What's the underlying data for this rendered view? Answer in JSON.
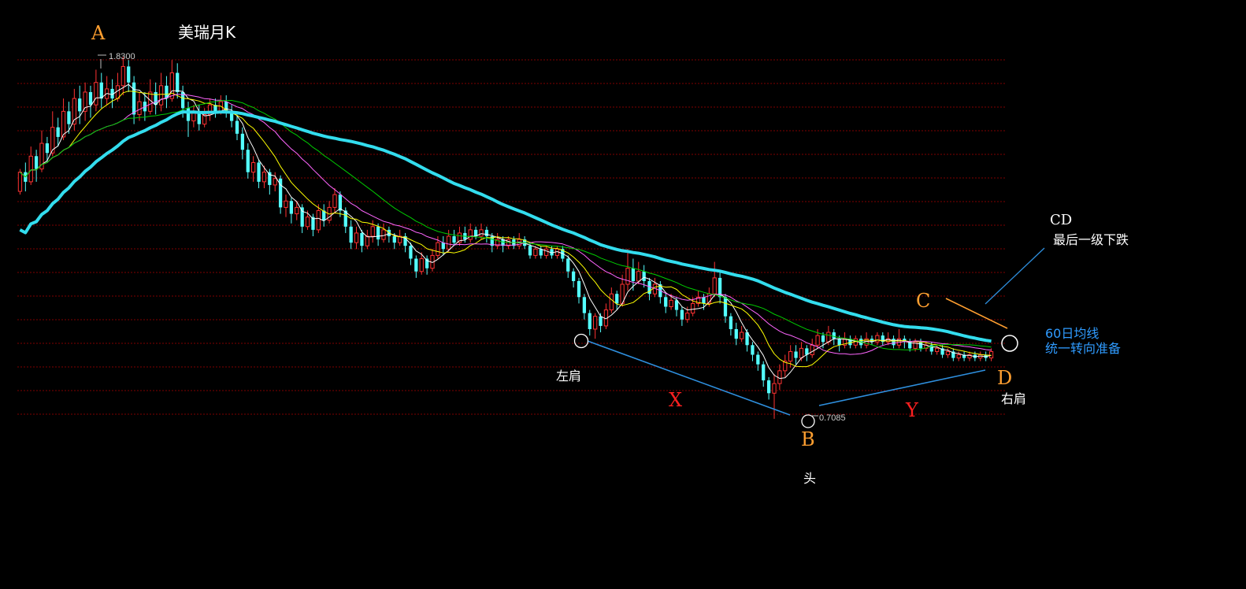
{
  "chart_data": {
    "type": "candlestick",
    "title": "美瑞月K",
    "price_labels": {
      "high": "1.8300",
      "low": "0.7085"
    },
    "ylim": [
      0.68,
      1.86
    ],
    "candle_count": 210,
    "candles": [
      {
        "o": 1.41,
        "c": 1.47,
        "h": 1.48,
        "l": 1.4
      },
      {
        "o": 1.47,
        "c": 1.44,
        "h": 1.5,
        "l": 1.41
      },
      {
        "o": 1.44,
        "c": 1.52,
        "h": 1.55,
        "l": 1.43
      },
      {
        "o": 1.52,
        "c": 1.48,
        "h": 1.54,
        "l": 1.44
      },
      {
        "o": 1.48,
        "c": 1.56,
        "h": 1.6,
        "l": 1.47
      },
      {
        "o": 1.56,
        "c": 1.53,
        "h": 1.58,
        "l": 1.5
      },
      {
        "o": 1.53,
        "c": 1.61,
        "h": 1.66,
        "l": 1.52
      },
      {
        "o": 1.61,
        "c": 1.58,
        "h": 1.64,
        "l": 1.55
      },
      {
        "o": 1.58,
        "c": 1.66,
        "h": 1.7,
        "l": 1.57
      },
      {
        "o": 1.66,
        "c": 1.62,
        "h": 1.69,
        "l": 1.59
      },
      {
        "o": 1.62,
        "c": 1.7,
        "h": 1.73,
        "l": 1.6
      },
      {
        "o": 1.7,
        "c": 1.66,
        "h": 1.74,
        "l": 1.62
      },
      {
        "o": 1.66,
        "c": 1.72,
        "h": 1.75,
        "l": 1.63
      },
      {
        "o": 1.72,
        "c": 1.68,
        "h": 1.74,
        "l": 1.64
      },
      {
        "o": 1.68,
        "c": 1.75,
        "h": 1.79,
        "l": 1.66
      },
      {
        "o": 1.75,
        "c": 1.7,
        "h": 1.78,
        "l": 1.67
      },
      {
        "o": 1.7,
        "c": 1.73,
        "h": 1.77,
        "l": 1.68
      },
      {
        "o": 1.73,
        "c": 1.7,
        "h": 1.76,
        "l": 1.67
      },
      {
        "o": 1.7,
        "c": 1.74,
        "h": 1.78,
        "l": 1.69
      },
      {
        "o": 1.74,
        "c": 1.8,
        "h": 1.83,
        "l": 1.71
      },
      {
        "o": 1.8,
        "c": 1.75,
        "h": 1.82,
        "l": 1.72
      },
      {
        "o": 1.75,
        "c": 1.65,
        "h": 1.77,
        "l": 1.62
      },
      {
        "o": 1.65,
        "c": 1.69,
        "h": 1.72,
        "l": 1.63
      },
      {
        "o": 1.69,
        "c": 1.66,
        "h": 1.72,
        "l": 1.63
      },
      {
        "o": 1.66,
        "c": 1.72,
        "h": 1.76,
        "l": 1.65
      },
      {
        "o": 1.72,
        "c": 1.68,
        "h": 1.75,
        "l": 1.65
      },
      {
        "o": 1.68,
        "c": 1.74,
        "h": 1.78,
        "l": 1.66
      },
      {
        "o": 1.74,
        "c": 1.7,
        "h": 1.77,
        "l": 1.67
      },
      {
        "o": 1.7,
        "c": 1.78,
        "h": 1.82,
        "l": 1.69
      },
      {
        "o": 1.78,
        "c": 1.72,
        "h": 1.81,
        "l": 1.7
      },
      {
        "o": 1.72,
        "c": 1.67,
        "h": 1.74,
        "l": 1.64
      },
      {
        "o": 1.67,
        "c": 1.63,
        "h": 1.69,
        "l": 1.58
      },
      {
        "o": 1.63,
        "c": 1.66,
        "h": 1.68,
        "l": 1.61
      },
      {
        "o": 1.66,
        "c": 1.62,
        "h": 1.68,
        "l": 1.6
      },
      {
        "o": 1.62,
        "c": 1.65,
        "h": 1.67,
        "l": 1.61
      },
      {
        "o": 1.65,
        "c": 1.68,
        "h": 1.7,
        "l": 1.63
      },
      {
        "o": 1.68,
        "c": 1.66,
        "h": 1.7,
        "l": 1.64
      },
      {
        "o": 1.66,
        "c": 1.69,
        "h": 1.71,
        "l": 1.65
      },
      {
        "o": 1.69,
        "c": 1.66,
        "h": 1.71,
        "l": 1.64
      },
      {
        "o": 1.66,
        "c": 1.63,
        "h": 1.68,
        "l": 1.61
      },
      {
        "o": 1.63,
        "c": 1.59,
        "h": 1.65,
        "l": 1.57
      },
      {
        "o": 1.59,
        "c": 1.54,
        "h": 1.61,
        "l": 1.51
      },
      {
        "o": 1.54,
        "c": 1.47,
        "h": 1.56,
        "l": 1.45
      },
      {
        "o": 1.47,
        "c": 1.5,
        "h": 1.52,
        "l": 1.44
      },
      {
        "o": 1.5,
        "c": 1.44,
        "h": 1.51,
        "l": 1.42
      },
      {
        "o": 1.44,
        "c": 1.47,
        "h": 1.49,
        "l": 1.42
      },
      {
        "o": 1.47,
        "c": 1.43,
        "h": 1.48,
        "l": 1.4
      },
      {
        "o": 1.43,
        "c": 1.45,
        "h": 1.47,
        "l": 1.41
      },
      {
        "o": 1.45,
        "c": 1.36,
        "h": 1.46,
        "l": 1.34
      },
      {
        "o": 1.36,
        "c": 1.38,
        "h": 1.4,
        "l": 1.33
      },
      {
        "o": 1.38,
        "c": 1.34,
        "h": 1.39,
        "l": 1.31
      },
      {
        "o": 1.34,
        "c": 1.36,
        "h": 1.38,
        "l": 1.32
      },
      {
        "o": 1.36,
        "c": 1.3,
        "h": 1.37,
        "l": 1.28
      },
      {
        "o": 1.3,
        "c": 1.33,
        "h": 1.35,
        "l": 1.29
      },
      {
        "o": 1.33,
        "c": 1.29,
        "h": 1.34,
        "l": 1.27
      },
      {
        "o": 1.29,
        "c": 1.35,
        "h": 1.37,
        "l": 1.28
      },
      {
        "o": 1.35,
        "c": 1.32,
        "h": 1.37,
        "l": 1.3
      },
      {
        "o": 1.32,
        "c": 1.36,
        "h": 1.38,
        "l": 1.31
      },
      {
        "o": 1.36,
        "c": 1.4,
        "h": 1.42,
        "l": 1.34
      },
      {
        "o": 1.4,
        "c": 1.35,
        "h": 1.41,
        "l": 1.33
      },
      {
        "o": 1.35,
        "c": 1.3,
        "h": 1.36,
        "l": 1.28
      },
      {
        "o": 1.3,
        "c": 1.25,
        "h": 1.32,
        "l": 1.23
      },
      {
        "o": 1.25,
        "c": 1.28,
        "h": 1.3,
        "l": 1.23
      },
      {
        "o": 1.28,
        "c": 1.24,
        "h": 1.29,
        "l": 1.22
      },
      {
        "o": 1.24,
        "c": 1.27,
        "h": 1.29,
        "l": 1.23
      },
      {
        "o": 1.27,
        "c": 1.3,
        "h": 1.32,
        "l": 1.25
      },
      {
        "o": 1.3,
        "c": 1.26,
        "h": 1.31,
        "l": 1.24
      },
      {
        "o": 1.26,
        "c": 1.29,
        "h": 1.31,
        "l": 1.25
      },
      {
        "o": 1.29,
        "c": 1.27,
        "h": 1.3,
        "l": 1.25
      },
      {
        "o": 1.27,
        "c": 1.25,
        "h": 1.28,
        "l": 1.23
      },
      {
        "o": 1.25,
        "c": 1.27,
        "h": 1.29,
        "l": 1.24
      },
      {
        "o": 1.27,
        "c": 1.24,
        "h": 1.28,
        "l": 1.22
      },
      {
        "o": 1.24,
        "c": 1.2,
        "h": 1.25,
        "l": 1.18
      },
      {
        "o": 1.2,
        "c": 1.16,
        "h": 1.21,
        "l": 1.14
      },
      {
        "o": 1.16,
        "c": 1.2,
        "h": 1.22,
        "l": 1.15
      },
      {
        "o": 1.2,
        "c": 1.17,
        "h": 1.21,
        "l": 1.15
      },
      {
        "o": 1.17,
        "c": 1.21,
        "h": 1.23,
        "l": 1.16
      },
      {
        "o": 1.21,
        "c": 1.25,
        "h": 1.27,
        "l": 1.2
      },
      {
        "o": 1.25,
        "c": 1.23,
        "h": 1.27,
        "l": 1.21
      },
      {
        "o": 1.23,
        "c": 1.27,
        "h": 1.29,
        "l": 1.22
      },
      {
        "o": 1.27,
        "c": 1.25,
        "h": 1.29,
        "l": 1.24
      },
      {
        "o": 1.25,
        "c": 1.28,
        "h": 1.3,
        "l": 1.24
      },
      {
        "o": 1.28,
        "c": 1.26,
        "h": 1.3,
        "l": 1.25
      },
      {
        "o": 1.26,
        "c": 1.29,
        "h": 1.31,
        "l": 1.25
      },
      {
        "o": 1.29,
        "c": 1.27,
        "h": 1.3,
        "l": 1.26
      },
      {
        "o": 1.27,
        "c": 1.29,
        "h": 1.31,
        "l": 1.26
      },
      {
        "o": 1.29,
        "c": 1.27,
        "h": 1.3,
        "l": 1.25
      },
      {
        "o": 1.27,
        "c": 1.24,
        "h": 1.28,
        "l": 1.22
      },
      {
        "o": 1.24,
        "c": 1.26,
        "h": 1.28,
        "l": 1.23
      },
      {
        "o": 1.26,
        "c": 1.24,
        "h": 1.27,
        "l": 1.22
      },
      {
        "o": 1.24,
        "c": 1.26,
        "h": 1.27,
        "l": 1.23
      },
      {
        "o": 1.26,
        "c": 1.24,
        "h": 1.27,
        "l": 1.23
      },
      {
        "o": 1.24,
        "c": 1.26,
        "h": 1.28,
        "l": 1.23
      },
      {
        "o": 1.26,
        "c": 1.24,
        "h": 1.27,
        "l": 1.23
      },
      {
        "o": 1.24,
        "c": 1.21,
        "h": 1.25,
        "l": 1.2
      },
      {
        "o": 1.21,
        "c": 1.23,
        "h": 1.24,
        "l": 1.2
      },
      {
        "o": 1.23,
        "c": 1.21,
        "h": 1.24,
        "l": 1.2
      },
      {
        "o": 1.21,
        "c": 1.23,
        "h": 1.24,
        "l": 1.2
      },
      {
        "o": 1.23,
        "c": 1.21,
        "h": 1.24,
        "l": 1.2
      },
      {
        "o": 1.21,
        "c": 1.23,
        "h": 1.24,
        "l": 1.2
      },
      {
        "o": 1.23,
        "c": 1.2,
        "h": 1.24,
        "l": 1.19
      },
      {
        "o": 1.2,
        "c": 1.16,
        "h": 1.21,
        "l": 1.14
      },
      {
        "o": 1.16,
        "c": 1.13,
        "h": 1.17,
        "l": 1.11
      },
      {
        "o": 1.13,
        "c": 1.08,
        "h": 1.14,
        "l": 1.06
      },
      {
        "o": 1.08,
        "c": 1.03,
        "h": 1.09,
        "l": 1.01
      },
      {
        "o": 1.03,
        "c": 0.98,
        "h": 1.04,
        "l": 0.96
      },
      {
        "o": 0.98,
        "c": 1.02,
        "h": 1.03,
        "l": 0.95
      },
      {
        "o": 1.02,
        "c": 0.99,
        "h": 1.03,
        "l": 0.97
      },
      {
        "o": 0.99,
        "c": 1.04,
        "h": 1.06,
        "l": 0.98
      },
      {
        "o": 1.04,
        "c": 1.09,
        "h": 1.11,
        "l": 1.03
      },
      {
        "o": 1.09,
        "c": 1.06,
        "h": 1.1,
        "l": 1.04
      },
      {
        "o": 1.06,
        "c": 1.12,
        "h": 1.15,
        "l": 1.05
      },
      {
        "o": 1.12,
        "c": 1.17,
        "h": 1.23,
        "l": 1.1
      },
      {
        "o": 1.17,
        "c": 1.13,
        "h": 1.2,
        "l": 1.1
      },
      {
        "o": 1.13,
        "c": 1.16,
        "h": 1.19,
        "l": 1.12
      },
      {
        "o": 1.16,
        "c": 1.13,
        "h": 1.18,
        "l": 1.11
      },
      {
        "o": 1.13,
        "c": 1.09,
        "h": 1.14,
        "l": 1.07
      },
      {
        "o": 1.09,
        "c": 1.12,
        "h": 1.14,
        "l": 1.08
      },
      {
        "o": 1.12,
        "c": 1.08,
        "h": 1.13,
        "l": 1.06
      },
      {
        "o": 1.08,
        "c": 1.05,
        "h": 1.09,
        "l": 1.03
      },
      {
        "o": 1.05,
        "c": 1.07,
        "h": 1.09,
        "l": 1.04
      },
      {
        "o": 1.07,
        "c": 1.04,
        "h": 1.08,
        "l": 1.02
      },
      {
        "o": 1.04,
        "c": 1.01,
        "h": 1.05,
        "l": 0.99
      },
      {
        "o": 1.01,
        "c": 1.03,
        "h": 1.05,
        "l": 1.0
      },
      {
        "o": 1.03,
        "c": 1.06,
        "h": 1.08,
        "l": 1.02
      },
      {
        "o": 1.06,
        "c": 1.08,
        "h": 1.1,
        "l": 1.05
      },
      {
        "o": 1.08,
        "c": 1.06,
        "h": 1.09,
        "l": 1.04
      },
      {
        "o": 1.06,
        "c": 1.09,
        "h": 1.11,
        "l": 1.05
      },
      {
        "o": 1.09,
        "c": 1.14,
        "h": 1.19,
        "l": 1.08
      },
      {
        "o": 1.14,
        "c": 1.08,
        "h": 1.16,
        "l": 1.06
      },
      {
        "o": 1.08,
        "c": 1.02,
        "h": 1.09,
        "l": 1.0
      },
      {
        "o": 1.02,
        "c": 0.98,
        "h": 1.03,
        "l": 0.96
      },
      {
        "o": 0.98,
        "c": 0.95,
        "h": 1.0,
        "l": 0.93
      },
      {
        "o": 0.95,
        "c": 0.97,
        "h": 0.99,
        "l": 0.94
      },
      {
        "o": 0.97,
        "c": 0.93,
        "h": 0.98,
        "l": 0.91
      },
      {
        "o": 0.93,
        "c": 0.9,
        "h": 0.94,
        "l": 0.88
      },
      {
        "o": 0.9,
        "c": 0.87,
        "h": 0.91,
        "l": 0.85
      },
      {
        "o": 0.87,
        "c": 0.82,
        "h": 0.88,
        "l": 0.8
      },
      {
        "o": 0.82,
        "c": 0.78,
        "h": 0.83,
        "l": 0.76
      },
      {
        "o": 0.78,
        "c": 0.81,
        "h": 0.84,
        "l": 0.7
      },
      {
        "o": 0.81,
        "c": 0.85,
        "h": 0.87,
        "l": 0.79
      },
      {
        "o": 0.85,
        "c": 0.88,
        "h": 0.9,
        "l": 0.83
      },
      {
        "o": 0.88,
        "c": 0.91,
        "h": 0.93,
        "l": 0.86
      },
      {
        "o": 0.91,
        "c": 0.89,
        "h": 0.93,
        "l": 0.87
      },
      {
        "o": 0.89,
        "c": 0.92,
        "h": 0.94,
        "l": 0.88
      },
      {
        "o": 0.92,
        "c": 0.9,
        "h": 0.93,
        "l": 0.88
      },
      {
        "o": 0.9,
        "c": 0.93,
        "h": 0.95,
        "l": 0.89
      },
      {
        "o": 0.93,
        "c": 0.96,
        "h": 0.98,
        "l": 0.92
      },
      {
        "o": 0.96,
        "c": 0.94,
        "h": 0.97,
        "l": 0.92
      },
      {
        "o": 0.94,
        "c": 0.97,
        "h": 0.99,
        "l": 0.93
      },
      {
        "o": 0.97,
        "c": 0.95,
        "h": 0.98,
        "l": 0.93
      },
      {
        "o": 0.95,
        "c": 0.93,
        "h": 0.96,
        "l": 0.91
      },
      {
        "o": 0.93,
        "c": 0.95,
        "h": 0.97,
        "l": 0.92
      },
      {
        "o": 0.95,
        "c": 0.93,
        "h": 0.96,
        "l": 0.92
      },
      {
        "o": 0.93,
        "c": 0.95,
        "h": 0.96,
        "l": 0.92
      },
      {
        "o": 0.95,
        "c": 0.93,
        "h": 0.96,
        "l": 0.92
      },
      {
        "o": 0.93,
        "c": 0.95,
        "h": 0.97,
        "l": 0.92
      },
      {
        "o": 0.95,
        "c": 0.94,
        "h": 0.96,
        "l": 0.93
      },
      {
        "o": 0.94,
        "c": 0.96,
        "h": 0.97,
        "l": 0.93
      },
      {
        "o": 0.96,
        "c": 0.94,
        "h": 0.97,
        "l": 0.93
      },
      {
        "o": 0.94,
        "c": 0.95,
        "h": 0.97,
        "l": 0.93
      },
      {
        "o": 0.95,
        "c": 0.93,
        "h": 0.96,
        "l": 0.92
      },
      {
        "o": 0.93,
        "c": 0.95,
        "h": 0.98,
        "l": 0.92
      },
      {
        "o": 0.95,
        "c": 0.94,
        "h": 0.96,
        "l": 0.92
      },
      {
        "o": 0.94,
        "c": 0.92,
        "h": 0.95,
        "l": 0.91
      },
      {
        "o": 0.92,
        "c": 0.94,
        "h": 0.95,
        "l": 0.91
      },
      {
        "o": 0.94,
        "c": 0.92,
        "h": 0.95,
        "l": 0.91
      },
      {
        "o": 0.92,
        "c": 0.93,
        "h": 0.94,
        "l": 0.91
      },
      {
        "o": 0.93,
        "c": 0.91,
        "h": 0.94,
        "l": 0.9
      },
      {
        "o": 0.91,
        "c": 0.92,
        "h": 0.93,
        "l": 0.9
      },
      {
        "o": 0.92,
        "c": 0.9,
        "h": 0.93,
        "l": 0.89
      },
      {
        "o": 0.9,
        "c": 0.91,
        "h": 0.92,
        "l": 0.89
      },
      {
        "o": 0.91,
        "c": 0.89,
        "h": 0.92,
        "l": 0.88
      },
      {
        "o": 0.89,
        "c": 0.9,
        "h": 0.91,
        "l": 0.88
      },
      {
        "o": 0.9,
        "c": 0.89,
        "h": 0.91,
        "l": 0.88
      },
      {
        "o": 0.89,
        "c": 0.9,
        "h": 0.91,
        "l": 0.88
      },
      {
        "o": 0.9,
        "c": 0.89,
        "h": 0.91,
        "l": 0.88
      },
      {
        "o": 0.89,
        "c": 0.9,
        "h": 0.91,
        "l": 0.88
      },
      {
        "o": 0.9,
        "c": 0.89,
        "h": 0.91,
        "l": 0.88
      },
      {
        "o": 0.89,
        "c": 0.91,
        "h": 0.92,
        "l": 0.88
      }
    ],
    "moving_averages": [
      {
        "period": 5,
        "color": "#ffffff",
        "width": 1
      },
      {
        "period": 10,
        "color": "#ffff00",
        "width": 1
      },
      {
        "period": 20,
        "color": "#ff66ff",
        "width": 1
      },
      {
        "period": 30,
        "color": "#00cc00",
        "width": 1
      },
      {
        "period": 60,
        "color": "#33ddee",
        "width": 4
      }
    ],
    "colors": {
      "up": "#ff3232",
      "down": "#54ffff",
      "grid": "#800000",
      "background": "#000000"
    },
    "grid": true,
    "points": {
      "A": "A",
      "B": "B",
      "C": "C",
      "D": "D",
      "X": "X",
      "Y": "Y"
    },
    "annotations": {
      "left_shoulder": "左肩",
      "head": "头",
      "right_shoulder": "右肩",
      "cd_title": "CD",
      "cd_text": "最后一级下跌",
      "ma60_line1": "60日均线",
      "ma60_line2": "统一转向准备"
    }
  }
}
